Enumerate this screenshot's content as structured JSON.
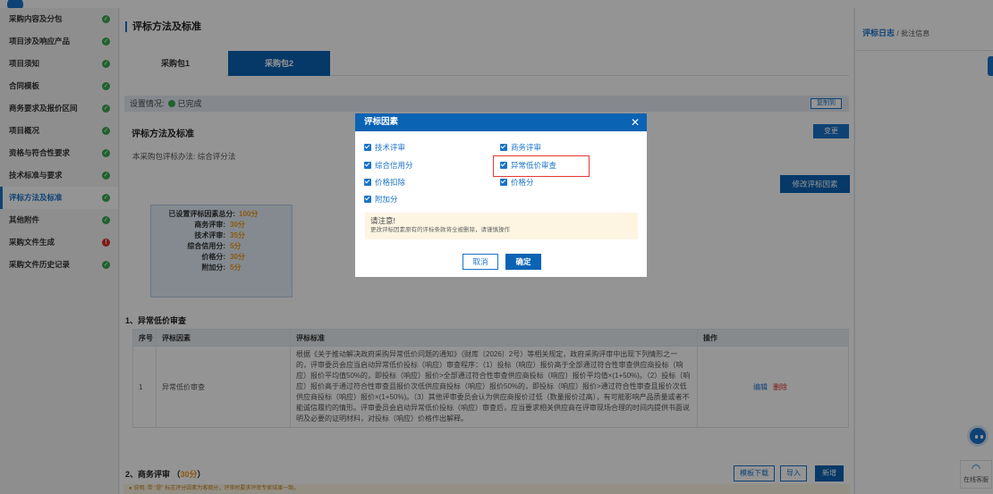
{
  "sidebar": {
    "items": [
      {
        "label": "采购内容及分包",
        "status": "ok",
        "active": false
      },
      {
        "label": "项目涉及响应产品",
        "status": "ok",
        "active": false
      },
      {
        "label": "项目须知",
        "status": "ok",
        "active": false
      },
      {
        "label": "合同模板",
        "status": "ok",
        "active": false
      },
      {
        "label": "商务要求及报价区间",
        "status": "ok",
        "active": false
      },
      {
        "label": "项目概况",
        "status": "ok",
        "active": false
      },
      {
        "label": "资格与符合性要求",
        "status": "ok",
        "active": false
      },
      {
        "label": "技术标准与要求",
        "status": "ok",
        "active": false
      },
      {
        "label": "评标方法及标准",
        "status": "ok",
        "active": true
      },
      {
        "label": "其他附件",
        "status": "ok",
        "active": false
      },
      {
        "label": "采购文件生成",
        "status": "error",
        "active": false
      },
      {
        "label": "采购文件历史记录",
        "status": "ok",
        "active": false
      }
    ]
  },
  "main": {
    "title": "评标方法及标准",
    "tabs": [
      {
        "label": "采购包1"
      },
      {
        "label": "采购包2"
      }
    ],
    "setting": {
      "label": "设置情况:",
      "value": "已完成",
      "copy_btn": "复制到"
    },
    "section_title": "评标方法及标准",
    "change_btn": "变更",
    "method_text": "本采购包评标办法: 综合评分法",
    "modify_factor_btn": "修改评标因素",
    "scores": {
      "total_label": "已设置评标因素总分:",
      "total_value": "100分",
      "rows": [
        {
          "label": "商务评审:",
          "value": "30分"
        },
        {
          "label": "技术评审:",
          "value": "35分"
        },
        {
          "label": "综合信用分:",
          "value": "5分"
        },
        {
          "label": "价格分:",
          "value": "30分"
        },
        {
          "label": "附加分:",
          "value": "5分"
        }
      ]
    },
    "section1": {
      "title": "1、异常低价审查",
      "headers": [
        "序号",
        "评标因素",
        "评标标准",
        "操作"
      ],
      "rows": [
        {
          "no": "1",
          "factor": "异常低价审查",
          "criteria": "根据《关于推动解决政府采购异常低价问题的通知》（财库〔2026〕2号）等相关规定，政府采购评审中出现下列情形之一的，评审委员会应当启动异常低价投标（响应）审查程序：（1）投标（响应）报价高于全部通过符合性审查供应商投标（响应）报价平均值50%的，即投标（响应）报价>全部通过符合性审查供应商投标（响应）报价平均值×(1+50%)。（2）投标（响应）报价高于通过符合性审查且报价次低供应商投标（响应）报价50%的，即投标（响应）报价>通过符合性审查且报价次低供应商投标（响应）报价×(1+50%)。（3）其他评审委员会认为供应商报价过低（数量报价过高），有可能影响产品质量或者不能诚信履约的情形。评审委员会启动异常低价投标（响应）审查后，应当要求相关供应商在评审现场合理的时间内提供书面说明及必要的证明材料，对投标（响应）价格作出解释。",
          "edit": "编辑",
          "delete": "删除"
        }
      ]
    },
    "section2": {
      "title": "2、商务评审",
      "points": "30分",
      "buttons": {
        "template": "模板下载",
        "import": "导入",
        "add": "新增"
      },
      "note": "● 说明: 带 \"是\" 标志评分因素为客观分，评审时要求评审专家结果一致。"
    }
  },
  "right_panel": {
    "title_a": "评标日志",
    "sep": "/",
    "title_b": "批注信息",
    "cs_label": "在线客服"
  },
  "modal": {
    "title": "评标因素",
    "options": [
      {
        "label": "技术评审",
        "checked": true
      },
      {
        "label": "商务评审",
        "checked": true
      },
      {
        "label": "综合信用分",
        "checked": true
      },
      {
        "label": "异常低价审查",
        "checked": true
      },
      {
        "label": "价格扣除",
        "checked": true
      },
      {
        "label": "价格分",
        "checked": true
      },
      {
        "label": "附加分",
        "checked": true
      }
    ],
    "warning_title": "请注意!",
    "warning_text": "更改评标因素原有的评标条款将全被删除，请谨慎操作",
    "cancel": "取消",
    "confirm": "确定"
  }
}
